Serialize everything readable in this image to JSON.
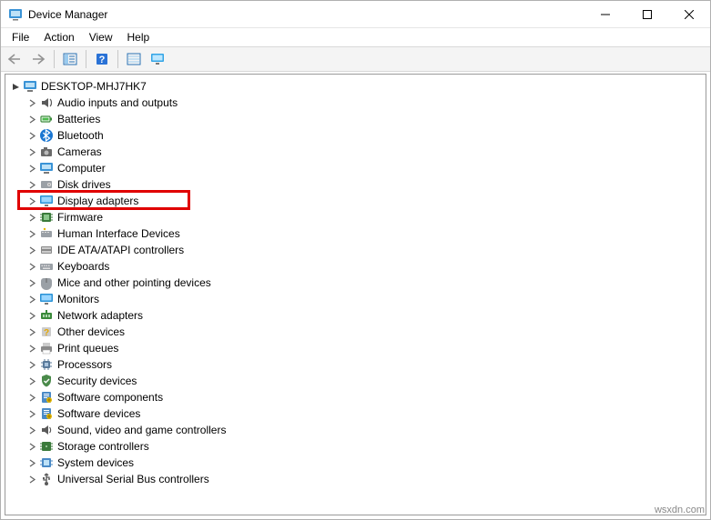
{
  "window": {
    "title": "Device Manager"
  },
  "menu": {
    "file": "File",
    "action": "Action",
    "view": "View",
    "help": "Help"
  },
  "toolbar": {
    "back": "Back",
    "forward": "Forward",
    "show_hide": "Show/Hide Console Tree",
    "help": "Help",
    "properties": "Properties",
    "show_hidden": "Show hidden devices"
  },
  "tree": {
    "root": "DESKTOP-MHJ7HK7",
    "nodes": [
      {
        "label": "Audio inputs and outputs",
        "icon": "audio"
      },
      {
        "label": "Batteries",
        "icon": "battery"
      },
      {
        "label": "Bluetooth",
        "icon": "bluetooth"
      },
      {
        "label": "Cameras",
        "icon": "camera"
      },
      {
        "label": "Computer",
        "icon": "computer"
      },
      {
        "label": "Disk drives",
        "icon": "disk"
      },
      {
        "label": "Display adapters",
        "icon": "display",
        "highlighted": true
      },
      {
        "label": "Firmware",
        "icon": "firmware"
      },
      {
        "label": "Human Interface Devices",
        "icon": "hid"
      },
      {
        "label": "IDE ATA/ATAPI controllers",
        "icon": "ide"
      },
      {
        "label": "Keyboards",
        "icon": "keyboard"
      },
      {
        "label": "Mice and other pointing devices",
        "icon": "mouse"
      },
      {
        "label": "Monitors",
        "icon": "monitor"
      },
      {
        "label": "Network adapters",
        "icon": "network"
      },
      {
        "label": "Other devices",
        "icon": "other"
      },
      {
        "label": "Print queues",
        "icon": "printer"
      },
      {
        "label": "Processors",
        "icon": "cpu"
      },
      {
        "label": "Security devices",
        "icon": "security"
      },
      {
        "label": "Software components",
        "icon": "software"
      },
      {
        "label": "Software devices",
        "icon": "software"
      },
      {
        "label": "Sound, video and game controllers",
        "icon": "sound"
      },
      {
        "label": "Storage controllers",
        "icon": "storage"
      },
      {
        "label": "System devices",
        "icon": "system"
      },
      {
        "label": "Universal Serial Bus controllers",
        "icon": "usb"
      }
    ]
  },
  "watermark": "wsxdn.com"
}
